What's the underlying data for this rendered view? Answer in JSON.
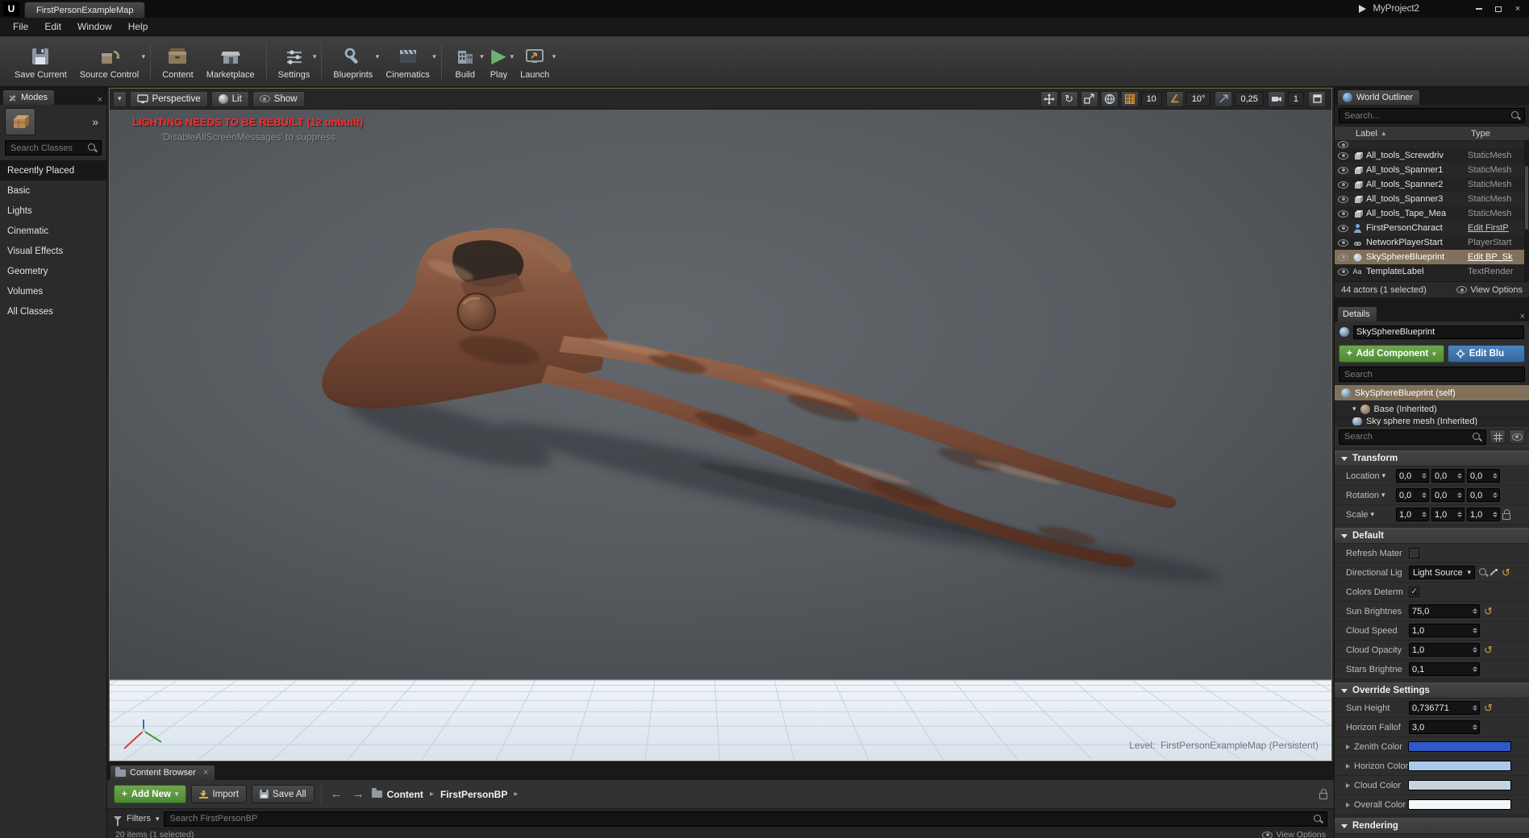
{
  "colors": {
    "accent_green": "#4c8a33",
    "edit_blue": "#35679c",
    "selection_tan": "#82715a",
    "warning_red": "#ff2d2d",
    "snap_orange": "#d79433"
  },
  "icons": {
    "close": "×",
    "caret_down": "▾",
    "arrow_right_small": "▸",
    "chevron_double": "»",
    "back": "←",
    "forward": "→",
    "reset": "↺",
    "sort_asc": "▲",
    "play": "▶",
    "rotate": "↻",
    "angle": "∠",
    "plus": "+",
    "check": "✓",
    "text_icon": "Aa"
  },
  "titlebar": {
    "tab_title": "FirstPersonExampleMap",
    "project_name": "MyProject2"
  },
  "menubar": {
    "items": [
      "File",
      "Edit",
      "Window",
      "Help"
    ]
  },
  "toolbar": {
    "buttons": [
      {
        "label": "Save Current"
      },
      {
        "label": "Source Control"
      },
      {
        "label": "Content"
      },
      {
        "label": "Marketplace"
      },
      {
        "label": "Settings"
      },
      {
        "label": "Blueprints"
      },
      {
        "label": "Cinematics"
      },
      {
        "label": "Build"
      },
      {
        "label": "Play"
      },
      {
        "label": "Launch"
      }
    ]
  },
  "modes": {
    "tab": "Modes",
    "search_placeholder": "Search Classes",
    "items": [
      "Recently Placed",
      "Basic",
      "Lights",
      "Cinematic",
      "Visual Effects",
      "Geometry",
      "Volumes",
      "All Classes"
    ]
  },
  "viewport": {
    "perspective": "Perspective",
    "lit": "Lit",
    "show": "Show",
    "warning_line1": "LIGHTING NEEDS TO BE REBUILT (12 unbuilt)",
    "warning_line2": "'DisableAllScreenMessages' to suppress",
    "grid_snap": "10",
    "rotation_snap": "10°",
    "scale_snap": "0,25",
    "camera_speed": "1",
    "level_label": "Level:",
    "level_name": "FirstPersonExampleMap (Persistent)"
  },
  "world_outliner": {
    "tab": "World Outliner",
    "search_placeholder": "Search...",
    "col_label": "Label",
    "col_type": "Type",
    "rows": [
      {
        "label": "All_tools_Screwdriv",
        "type": "StaticMesh"
      },
      {
        "label": "All_tools_Spanner1",
        "type": "StaticMesh"
      },
      {
        "label": "All_tools_Spanner2",
        "type": "StaticMesh"
      },
      {
        "label": "All_tools_Spanner3",
        "type": "StaticMesh"
      },
      {
        "label": "All_tools_Tape_Mea",
        "type": "StaticMesh"
      },
      {
        "label": "FirstPersonCharact",
        "type": "Edit FirstP"
      },
      {
        "label": "NetworkPlayerStart",
        "type": "PlayerStart"
      },
      {
        "label": "SkySphereBlueprint",
        "type": "Edit BP_Sk"
      },
      {
        "label": "TemplateLabel",
        "type": "TextRender"
      }
    ],
    "footer": "44 actors (1 selected)",
    "view_options": "View Options"
  },
  "details": {
    "tab": "Details",
    "name_value": "SkySphereBlueprint",
    "add_component": "Add Component",
    "edit_blueprint": "Edit Blu",
    "search_placeholder": "Search",
    "tree_self": "SkySphereBlueprint (self)",
    "tree_base": "Base (Inherited)",
    "tree_mesh": "Sky sphere mesh (Inherited)",
    "transform": {
      "title": "Transform",
      "location_label": "Location",
      "location": [
        "0,0",
        "0,0",
        "0,0"
      ],
      "rotation_label": "Rotation",
      "rotation": [
        "0,0",
        "0,0",
        "0,0"
      ],
      "scale_label": "Scale",
      "scale": [
        "1,0",
        "1,0",
        "1,0"
      ]
    },
    "default_section": {
      "title": "Default",
      "rows": [
        {
          "label": "Refresh Mater"
        },
        {
          "label": "Directional Lig",
          "value": "Light Source"
        },
        {
          "label": "Colors Determ"
        },
        {
          "label": "Sun Brightnes",
          "value": "75,0"
        },
        {
          "label": "Cloud Speed",
          "value": "1,0"
        },
        {
          "label": "Cloud Opacity",
          "value": "1,0"
        },
        {
          "label": "Stars Brightne",
          "value": "0,1"
        }
      ]
    },
    "override_section": {
      "title": "Override Settings",
      "rows": [
        {
          "label": "Sun Height",
          "value": "0,736771"
        },
        {
          "label": "Horizon Fallof",
          "value": "3,0"
        },
        {
          "label": "Zenith Color",
          "color": "#2e59c8"
        },
        {
          "label": "Horizon Color",
          "color": "#a9c9ea"
        },
        {
          "label": "Cloud Color",
          "color": "#c6d4e0"
        },
        {
          "label": "Overall Color",
          "color": "#f3f6f9"
        }
      ]
    },
    "rendering_section": {
      "title": "Rendering"
    }
  },
  "content_browser": {
    "tab": "Content Browser",
    "add_new": "Add New",
    "import": "Import",
    "save_all": "Save All",
    "path_root": "Content",
    "path_folder": "FirstPersonBP",
    "filters": "Filters",
    "search_placeholder": "Search FirstPersonBP",
    "status": "20 items (1 selected)",
    "view_options": "View Options"
  }
}
